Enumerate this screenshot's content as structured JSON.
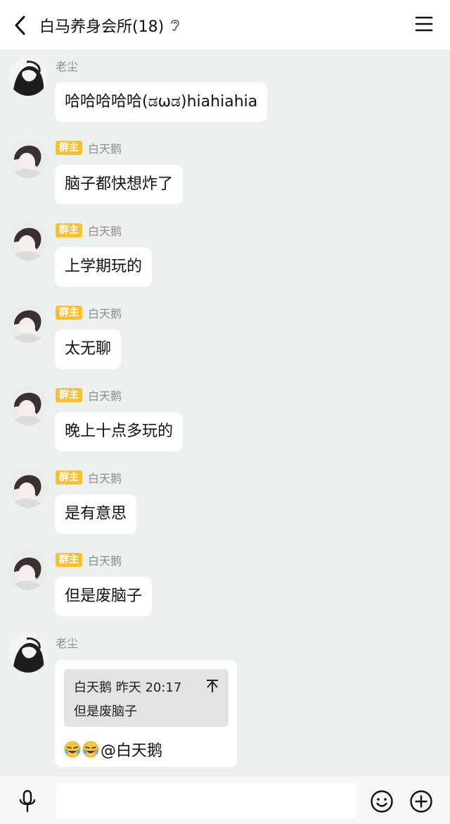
{
  "header": {
    "title": "白马养身会所(18)",
    "back_icon": "chevron-left-icon",
    "ear_icon": "ear-icon",
    "menu_icon": "hamburger-menu-icon"
  },
  "badge_color": "#f7c133",
  "chat_background": "#edf1ed",
  "messages": [
    {
      "sender": "老尘",
      "badge": "",
      "text": "哈哈哈哈哈(ಡωಡ)hiahiahia"
    },
    {
      "sender": "白天鹅",
      "badge": "群主",
      "text": "脑子都快想炸了"
    },
    {
      "sender": "白天鹅",
      "badge": "群主",
      "text": "上学期玩的"
    },
    {
      "sender": "白天鹅",
      "badge": "群主",
      "text": "太无聊"
    },
    {
      "sender": "白天鹅",
      "badge": "群主",
      "text": "晚上十点多玩的"
    },
    {
      "sender": "白天鹅",
      "badge": "群主",
      "text": "是有意思"
    },
    {
      "sender": "白天鹅",
      "badge": "群主",
      "text": "但是废脑子"
    }
  ],
  "reply_message": {
    "sender": "老尘",
    "quote_header": "白天鹅 昨天 20:17",
    "quote_text": "但是废脑子",
    "mention": "@白天鹅",
    "emoji_icon": "laughing-tears-emoji-icon"
  },
  "input_bar": {
    "placeholder": "",
    "mic_icon": "microphone-icon",
    "emoji_icon": "smiley-icon",
    "plus_icon": "plus-circle-icon"
  }
}
